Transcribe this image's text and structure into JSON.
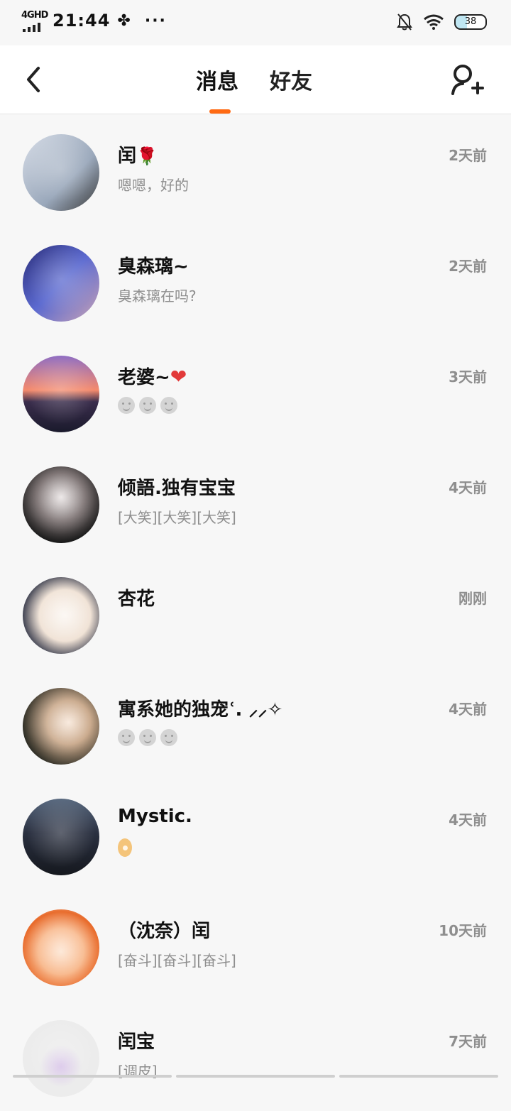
{
  "status_bar": {
    "network": "4GHD",
    "time": "21:44",
    "more": "···",
    "battery": "38"
  },
  "header": {
    "tabs": [
      {
        "label": "消息",
        "active": true
      },
      {
        "label": "好友",
        "active": false
      }
    ],
    "accent_color": "#ff6a13"
  },
  "conversations": [
    {
      "name": "闰",
      "name_suffix": "🌹",
      "preview": "嗯嗯，好的",
      "time": "2天前"
    },
    {
      "name": "臭森璃~",
      "preview": "臭森璃在吗?",
      "time": "2天前"
    },
    {
      "name": "老婆~",
      "name_suffix": "❤",
      "preview_icon": "smile-emoji x3",
      "time": "3天前"
    },
    {
      "name": "倾語.独有宝宝",
      "preview": "[大笑][大笑][大笑]",
      "time": "4天前"
    },
    {
      "name": "杏花",
      "preview": "",
      "time": "刚刚"
    },
    {
      "name": "寓系她的独宠ʿ. ⸝⸝✧",
      "preview_icon": "smile-emoji x3",
      "time": "4天前"
    },
    {
      "name": "Mystic.",
      "preview_icon": "ok-hand-emoji",
      "time": "4天前"
    },
    {
      "name": "（沈奈）闰",
      "preview": "[奋斗][奋斗][奋斗]",
      "time": "10天前"
    },
    {
      "name": "闰宝",
      "preview": "[调皮]",
      "time": "7天前"
    }
  ]
}
